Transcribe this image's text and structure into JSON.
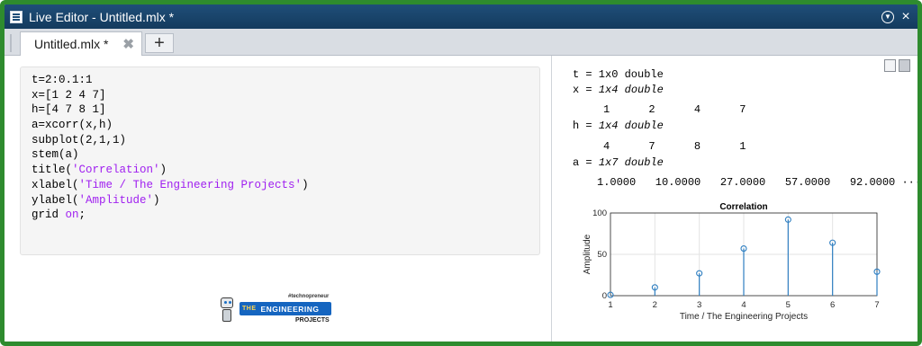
{
  "window": {
    "title": "Live Editor - Untitled.mlx *",
    "colors": {
      "titlebar": "#1f4e79",
      "frame": "#2e8b2e"
    }
  },
  "tabs": {
    "active_label": "Untitled.mlx *",
    "close_glyph": "✖",
    "add_glyph": "+"
  },
  "title_controls": {
    "menu_icon": "chevron-down-circle-icon",
    "close_icon": "close-icon",
    "menu_glyph": "▼",
    "close_glyph": "×"
  },
  "code": {
    "lines": [
      "t=2:0.1:1",
      "x=[1 2 4 7]",
      "h=[4 7 8 1]",
      "a=xcorr(x,h)",
      "subplot(2,1,1)",
      "stem(a)",
      "title('Correlation')",
      "xlabel('Time / The Engineering Projects')",
      "ylabel('Amplitude')",
      "grid on;"
    ]
  },
  "logo": {
    "tagline": "#technopreneur",
    "the": "THE",
    "main": "ENGINEERING",
    "sub": "PROJECTS"
  },
  "output": {
    "t_line": "t = 1x0 double",
    "x_label": "x = ",
    "x_type": "1x4 double",
    "x_values": "1      2      4      7",
    "h_label": "h = ",
    "h_type": "1x4 double",
    "h_values": "4      7      8      1",
    "a_label": "a = ",
    "a_type": "1x7 double",
    "a_values": "1.0000   10.0000   27.0000   57.0000   92.0000",
    "a_more": "···"
  },
  "chart_data": {
    "type": "stem",
    "title": "Correlation",
    "xlabel": "Time / The Engineering Projects",
    "ylabel": "Amplitude",
    "x": [
      1,
      2,
      3,
      4,
      5,
      6,
      7
    ],
    "values": [
      1,
      10,
      27,
      57,
      92,
      64,
      29
    ],
    "xlim": [
      1,
      7
    ],
    "ylim": [
      0,
      100
    ],
    "xticks": [
      "1",
      "2",
      "3",
      "4",
      "5",
      "6",
      "7"
    ],
    "yticks": [
      "0",
      "50",
      "100"
    ],
    "grid": true,
    "color": "#2f7fc1"
  }
}
